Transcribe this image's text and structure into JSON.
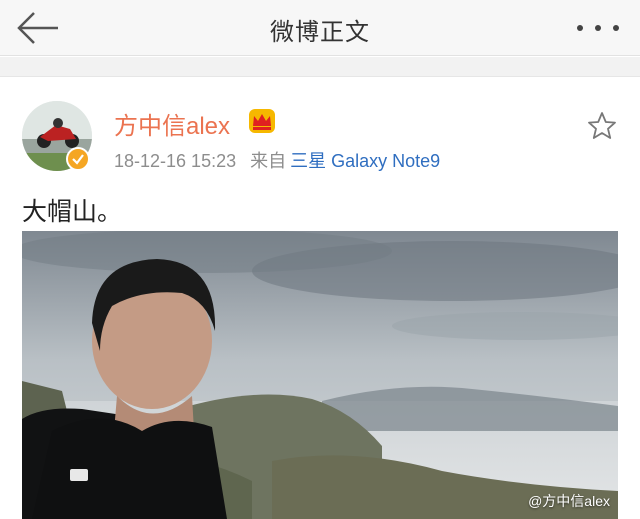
{
  "header": {
    "title": "微博正文",
    "back_icon": "arrow-left-icon",
    "more_icon": "more-dots-icon"
  },
  "post": {
    "username": "方中信alex",
    "crown_icon": "crown-icon",
    "verified_icon": "verified-badge-icon",
    "timestamp": "18-12-16 15:23",
    "source_prefix": "来自",
    "source_device": "三星 Galaxy Note9",
    "text": "大帽山。",
    "favorite_icon": "star-outline-icon",
    "image_watermark": "@方中信alex"
  },
  "colors": {
    "username": "#eb7350",
    "device_link": "#2f6ec0",
    "verified": "#f5a623",
    "meta": "#8d8d8d"
  }
}
